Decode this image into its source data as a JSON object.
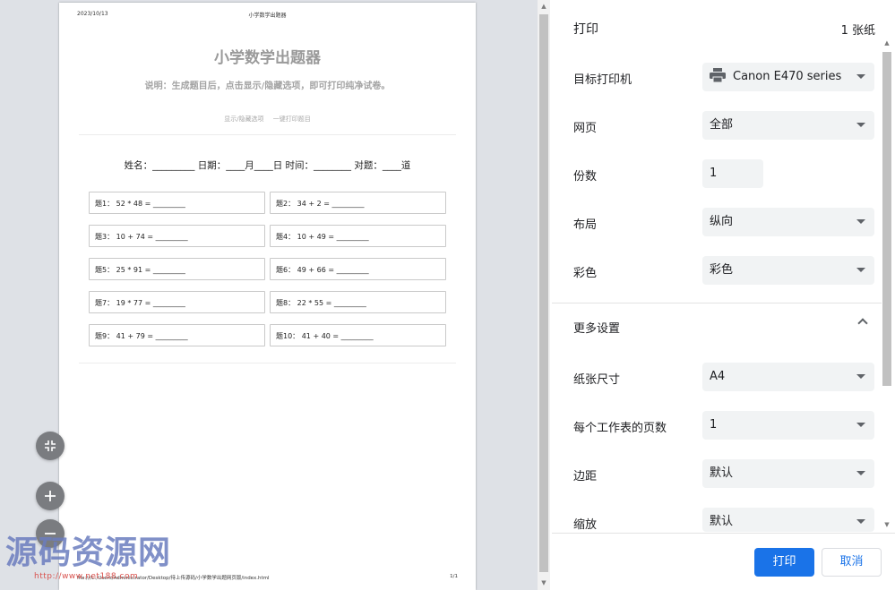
{
  "preview": {
    "header_date": "2023/10/13",
    "header_title": "小学数学出题器",
    "doc_title": "小学数学出题器",
    "doc_description": "说明：生成题目后，点击显示/隐藏选项，即可打印纯净试卷。",
    "links": [
      "显示/隐藏选项",
      "一键打印题目"
    ],
    "info_line": "姓名：_________ 日期：____月____日 时间：________ 对题：____道",
    "questions": [
      "题1：  52 * 48 = _________",
      "题2：  34 + 2 = _________",
      "题3：  10 + 74 = _________",
      "题4：  10 + 49 = _________",
      "题5：  25 * 91 = _________",
      "题6：  49 + 66 = _________",
      "题7：  19 * 77 = _________",
      "题8：  22 * 55 = _________",
      "题9：  41 + 79 = _________",
      "题10：  41 + 40 = _________"
    ],
    "footer_url": "file:///C:/Users/Administrator/Desktop/待上传源码/小学数学出题网页版/index.html",
    "footer_page": "1/1",
    "watermark_text": "源码资源网",
    "watermark_url": "http://www.net188.com"
  },
  "settings": {
    "title": "打印",
    "sheet_count": "1 张纸",
    "destination_label": "目标打印机",
    "destination_value": "Canon E470 series",
    "pages_label": "网页",
    "pages_value": "全部",
    "copies_label": "份数",
    "copies_value": "1",
    "layout_label": "布局",
    "layout_value": "纵向",
    "color_label": "彩色",
    "color_value": "彩色",
    "more_settings_label": "更多设置",
    "paper_size_label": "纸张尺寸",
    "paper_size_value": "A4",
    "pages_per_sheet_label": "每个工作表的页数",
    "pages_per_sheet_value": "1",
    "margins_label": "边距",
    "margins_value": "默认",
    "scale_label": "缩放",
    "scale_value": "默认",
    "print_button": "打印",
    "cancel_button": "取消"
  },
  "colors": {
    "primary": "#1a73e8",
    "preview_bg": "#dee1e6",
    "select_bg": "#f1f3f4"
  }
}
